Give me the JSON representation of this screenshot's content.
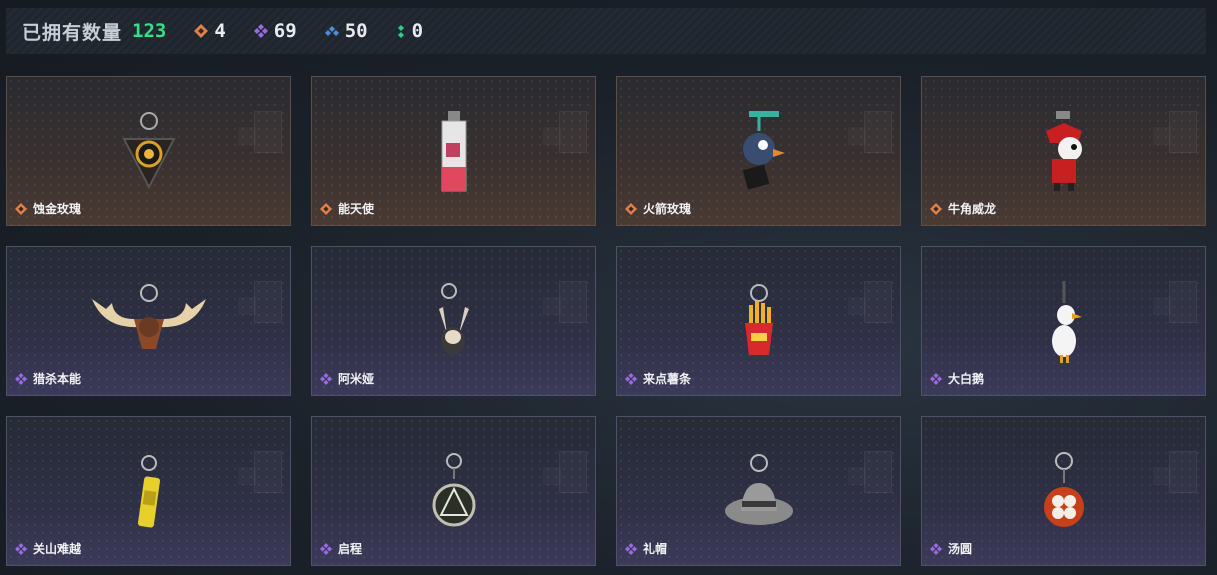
{
  "header": {
    "owned_label": "已拥有数量",
    "owned_count": "123",
    "stats": [
      {
        "icon": "orange-diamond-icon",
        "color": "#e0804a",
        "value": "4"
      },
      {
        "icon": "purple-diamond-icon",
        "color": "#9a6be0",
        "value": "69"
      },
      {
        "icon": "blue-diamond-icon",
        "color": "#4a90d9",
        "value": "50"
      },
      {
        "icon": "green-diamond-icon",
        "color": "#35c890",
        "value": "0"
      }
    ]
  },
  "items": [
    {
      "name": "蚀金玫瑰",
      "rarity": "orange",
      "icon": "rose-pendant-icon"
    },
    {
      "name": "能天使",
      "rarity": "orange",
      "icon": "angel-box-icon"
    },
    {
      "name": "火箭玫瑰",
      "rarity": "orange",
      "icon": "rocket-duck-icon"
    },
    {
      "name": "牛角威龙",
      "rarity": "orange",
      "icon": "red-dragon-icon"
    },
    {
      "name": "猎杀本能",
      "rarity": "purple",
      "icon": "antler-trophy-icon"
    },
    {
      "name": "阿米娅",
      "rarity": "purple",
      "icon": "rabbit-figure-icon"
    },
    {
      "name": "来点薯条",
      "rarity": "purple",
      "icon": "fries-icon"
    },
    {
      "name": "大白鹅",
      "rarity": "purple",
      "icon": "goose-icon"
    },
    {
      "name": "关山难越",
      "rarity": "purple",
      "icon": "yellow-can-icon"
    },
    {
      "name": "启程",
      "rarity": "purple",
      "icon": "mountain-medal-icon"
    },
    {
      "name": "礼帽",
      "rarity": "purple",
      "icon": "hat-icon"
    },
    {
      "name": "汤圆",
      "rarity": "purple",
      "icon": "tangyuan-bowl-icon"
    }
  ]
}
